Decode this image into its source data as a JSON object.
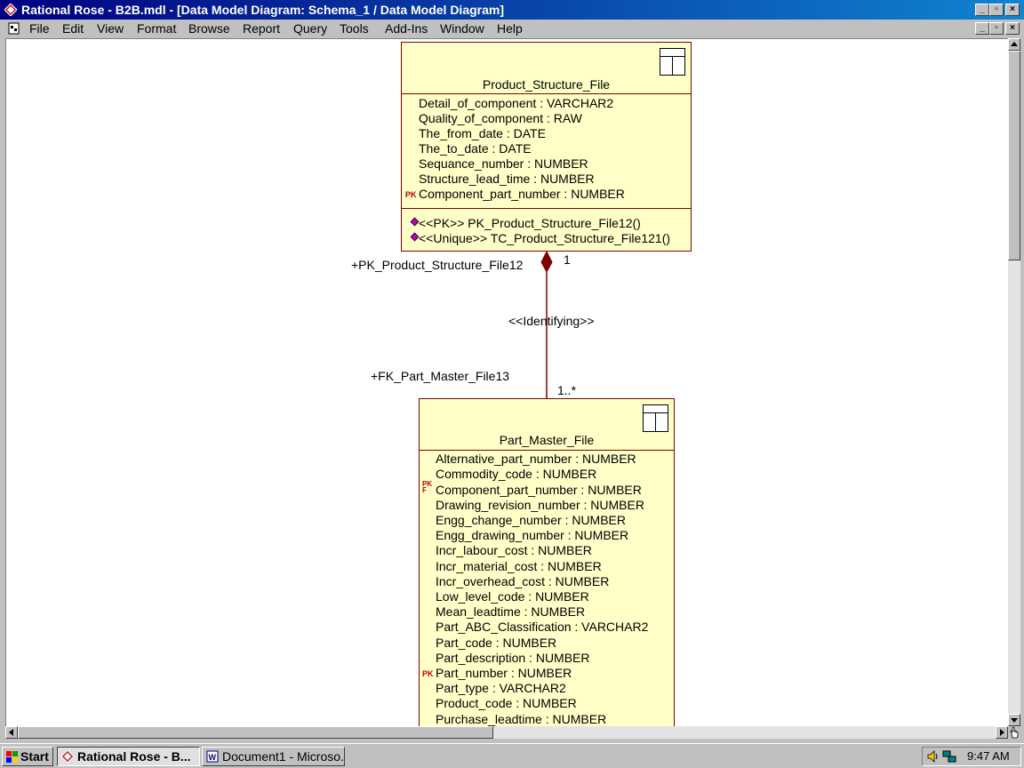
{
  "window": {
    "title": "Rational Rose - B2B.mdl - [Data Model Diagram: Schema_1 / Data Model Diagram]",
    "btn_min": "_",
    "btn_max": "▫",
    "btn_close": "×"
  },
  "menu": {
    "items": [
      "File",
      "Edit",
      "View",
      "Format",
      "Browse",
      "Report",
      "Query",
      "Tools",
      "Add-Ins",
      "Window",
      "Help"
    ]
  },
  "diagram": {
    "table1": {
      "name": "Product_Structure_File",
      "attributes": [
        "Detail_of_component : VARCHAR2",
        "Quality_of_component : RAW",
        "The_from_date : DATE",
        "The_to_date : DATE",
        "Sequance_number : NUMBER",
        "Structure_lead_time : NUMBER",
        "Component_part_number : NUMBER"
      ],
      "operations": [
        "<<PK>> PK_Product_Structure_File12()",
        "<<Unique>> TC_Product_Structure_File121()"
      ]
    },
    "table2": {
      "name": "Part_Master_File",
      "attributes": [
        "Alternative_part_number : NUMBER",
        "Commodity_code : NUMBER",
        "Component_part_number : NUMBER",
        "Drawing_revision_number : NUMBER",
        "Engg_change_number : NUMBER",
        "Engg_drawing_number : NUMBER",
        "Incr_labour_cost : NUMBER",
        "Incr_material_cost : NUMBER",
        "Incr_overhead_cost : NUMBER",
        "Low_level_code : NUMBER",
        "Mean_leadtime : NUMBER",
        "Part_ABC_Classification : VARCHAR2",
        "Part_code : NUMBER",
        "Part_description : NUMBER",
        "Part_number : NUMBER",
        "Part_type : VARCHAR2",
        "Product_code : NUMBER",
        "Purchase_leadtime : NUMBER"
      ]
    },
    "relationship": {
      "stereotype": "<<Identifying>>",
      "parent_role": "+PK_Product_Structure_File12",
      "child_role": "+FK_Part_Master_File13",
      "parent_multiplicity": "1",
      "child_multiplicity": "1..*"
    },
    "pk_marker": "PK",
    "pfk_marker_top": "P",
    "pfk_marker_bottom": "F"
  },
  "taskbar": {
    "start": "Start",
    "tasks": [
      "Rational Rose - B...",
      "Document1 - Microso..."
    ],
    "clock": "9:47 AM"
  },
  "colors": {
    "title_start": "#000080",
    "title_end": "#1084d0",
    "box_fill": "#ffffc8",
    "box_border": "#800000",
    "relationship_line": "#800000"
  }
}
